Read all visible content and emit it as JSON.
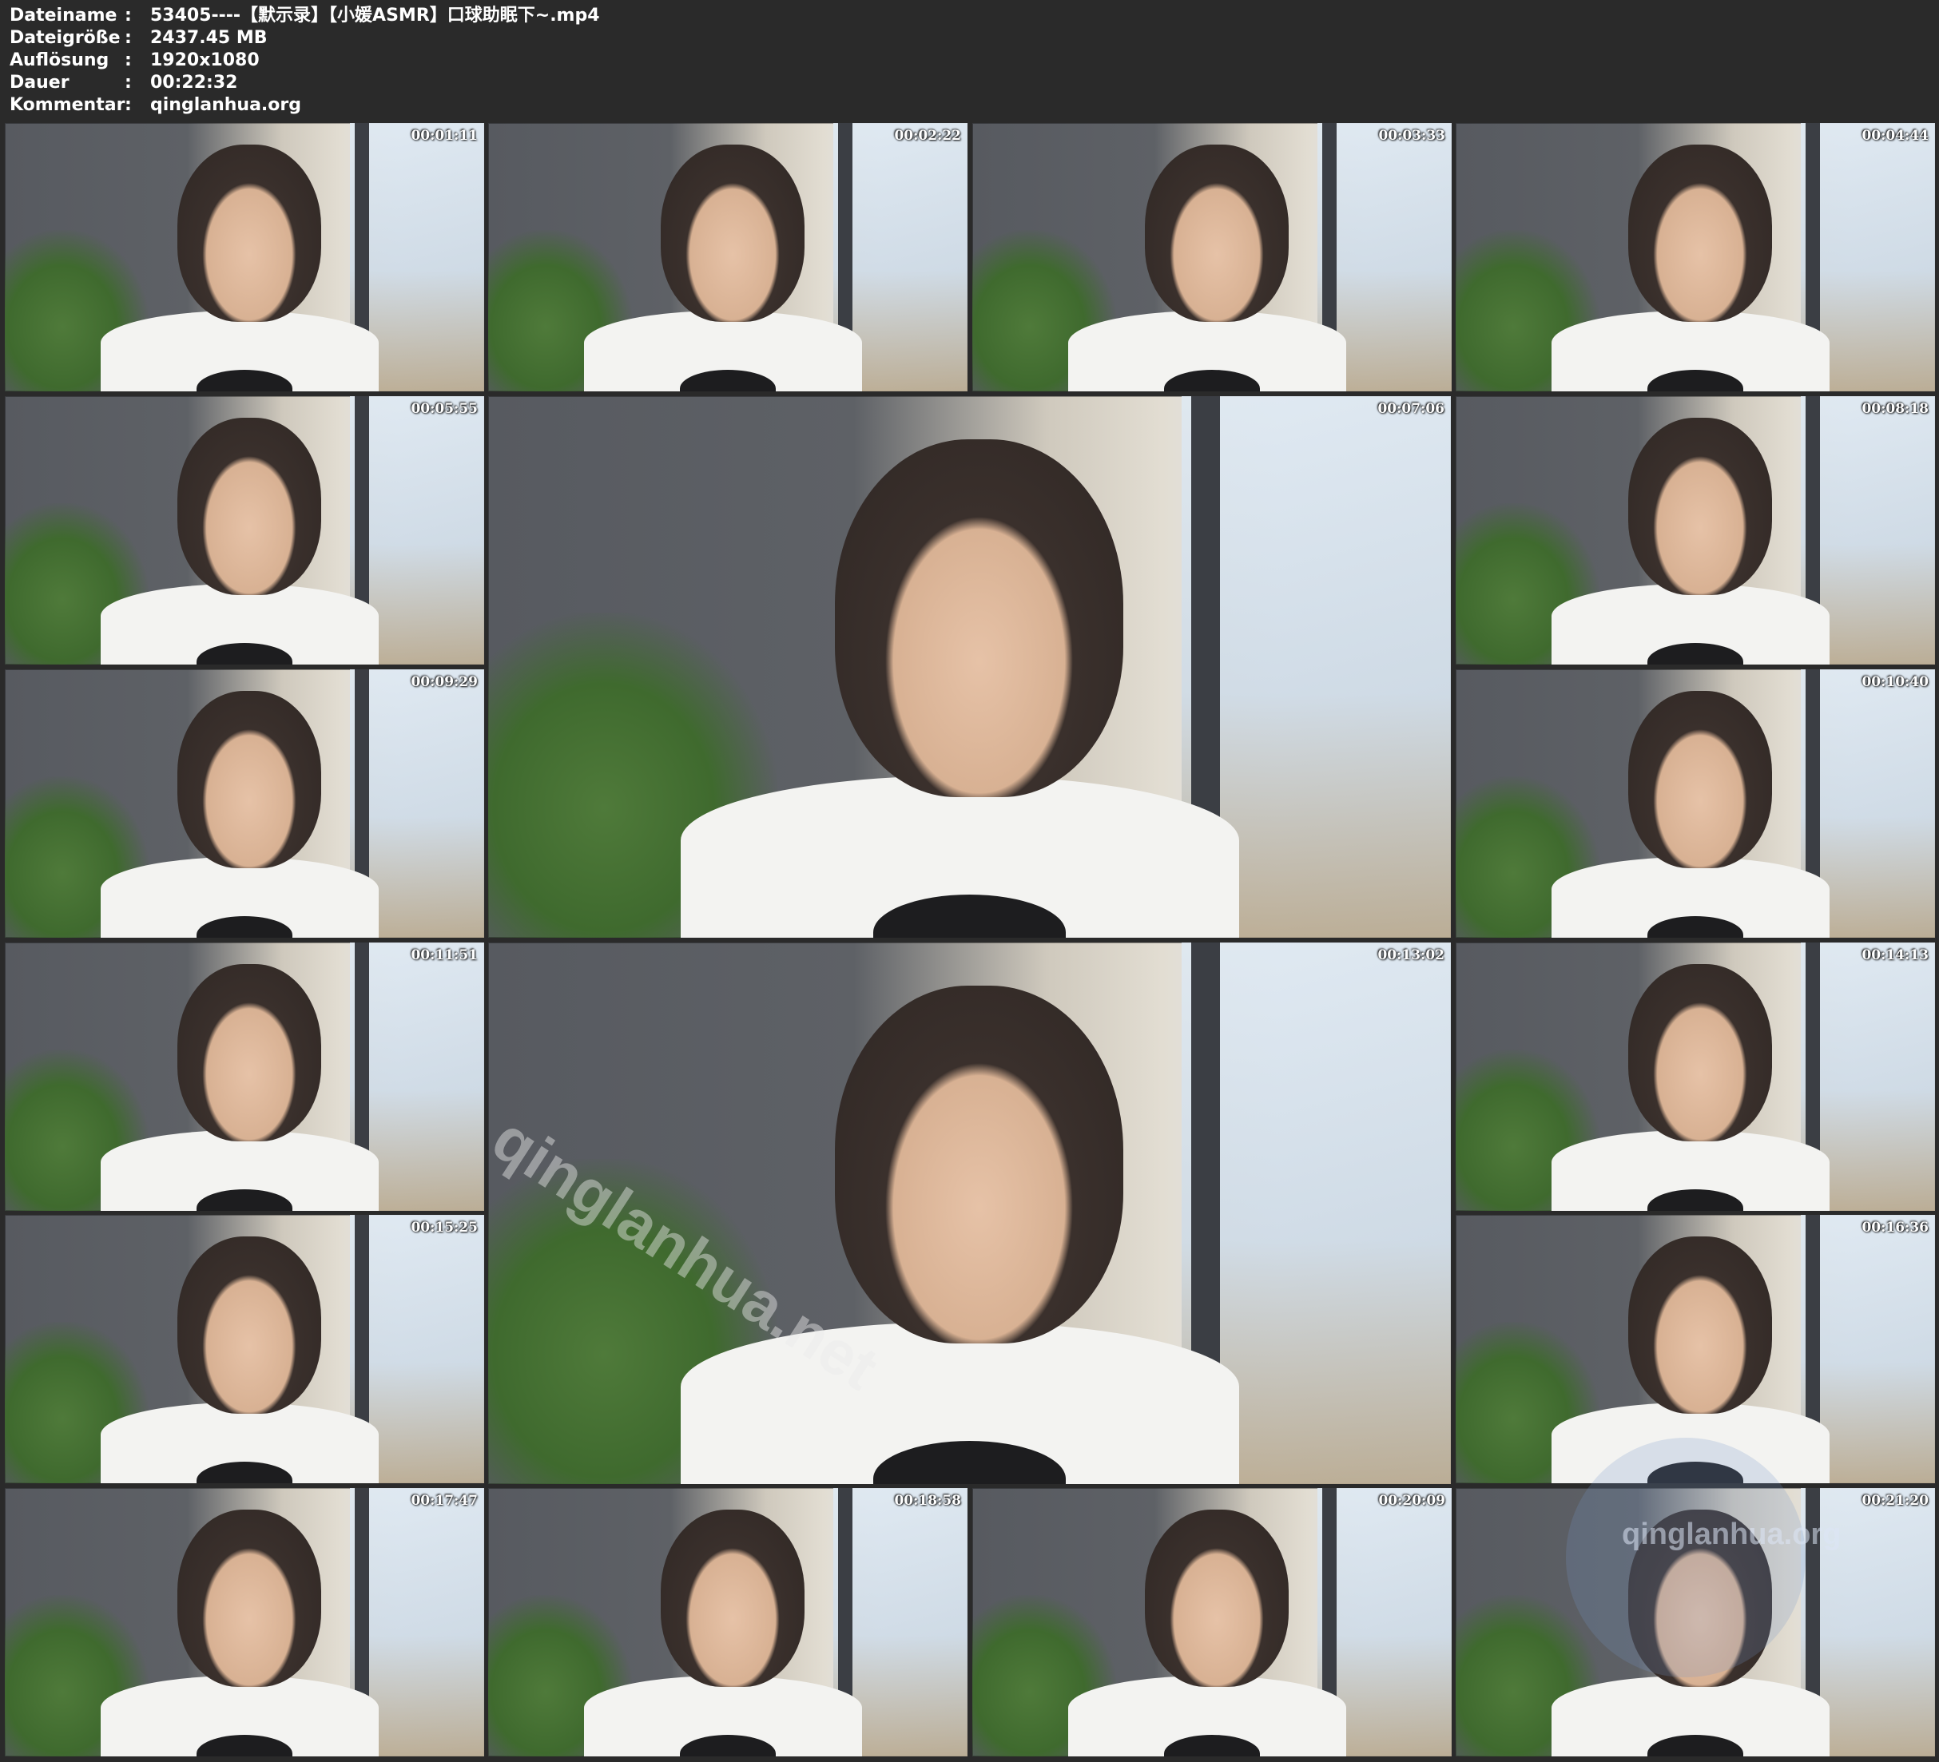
{
  "header": {
    "rows": [
      {
        "key": "Dateiname",
        "value": "53405----【默示录】【小媛ASMR】口球助眠下~.mp4"
      },
      {
        "key": "Dateigröße",
        "value": "2437.45 MB"
      },
      {
        "key": "Auflösung",
        "value": "1920x1080"
      },
      {
        "key": "Dauer",
        "value": "00:22:32"
      },
      {
        "key": "Kommentar",
        "value": "qinglanhua.org"
      }
    ],
    "separator": ":"
  },
  "frames": [
    {
      "timestamp": "00:01:11"
    },
    {
      "timestamp": "00:02:22"
    },
    {
      "timestamp": "00:03:33"
    },
    {
      "timestamp": "00:04:44"
    },
    {
      "timestamp": "00:05:55"
    },
    {
      "timestamp": "00:07:06"
    },
    {
      "timestamp": "00:08:18"
    },
    {
      "timestamp": "00:09:29"
    },
    {
      "timestamp": "00:10:40"
    },
    {
      "timestamp": "00:11:51"
    },
    {
      "timestamp": "00:13:02"
    },
    {
      "timestamp": "00:14:13"
    },
    {
      "timestamp": "00:15:25"
    },
    {
      "timestamp": "00:16:36"
    },
    {
      "timestamp": "00:17:47"
    },
    {
      "timestamp": "00:18:58"
    },
    {
      "timestamp": "00:20:09"
    },
    {
      "timestamp": "00:21:20"
    }
  ],
  "watermarks": {
    "center": "qinglanhua.net",
    "corner": "qinglanhua.org"
  },
  "colors": {
    "background": "#2a2a2a",
    "text": "#ffffff"
  }
}
